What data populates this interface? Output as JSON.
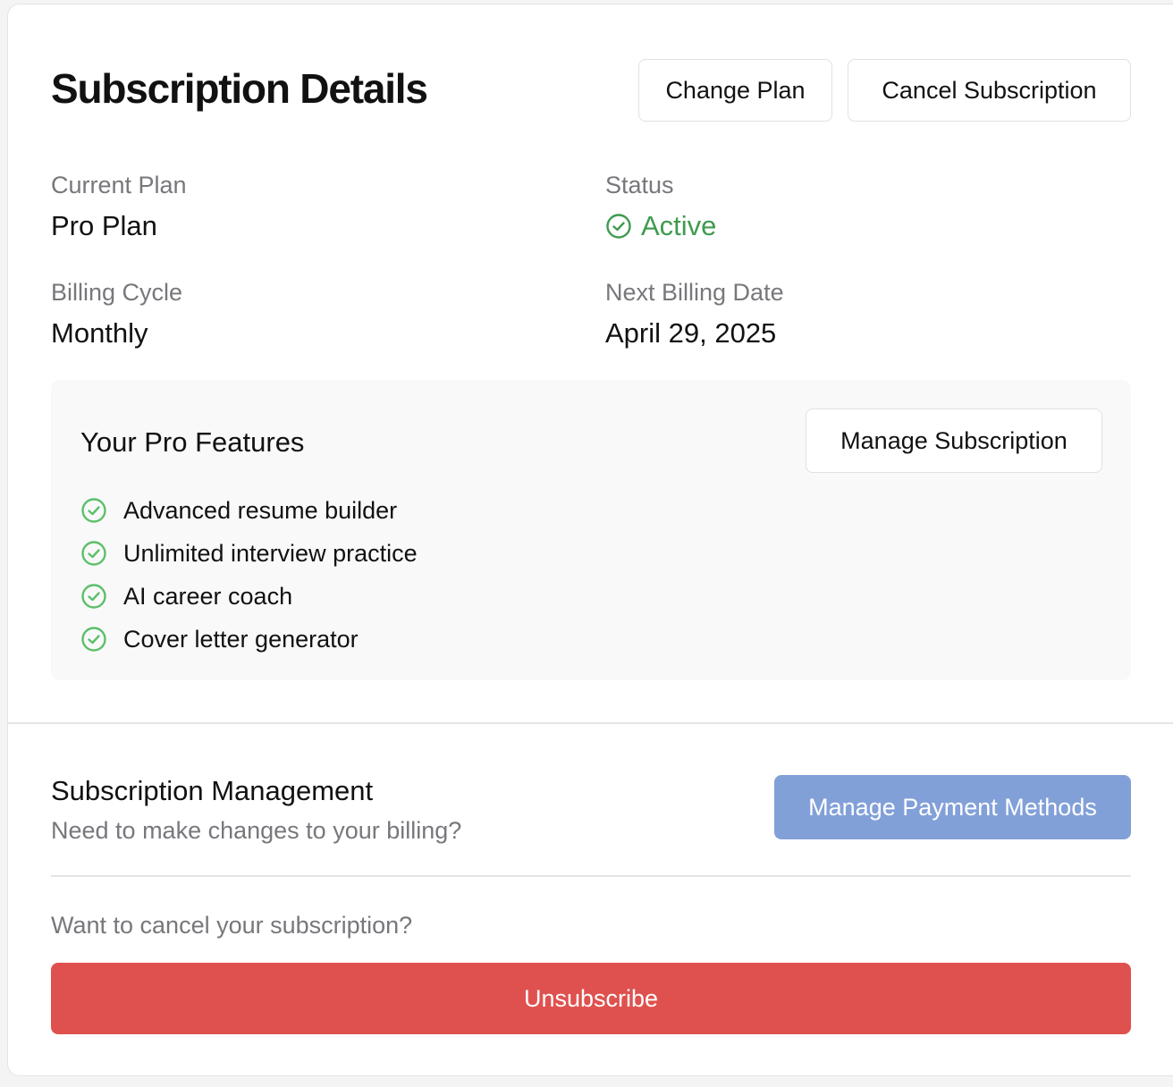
{
  "header": {
    "title": "Subscription Details",
    "change_plan_label": "Change Plan",
    "cancel_subscription_label": "Cancel Subscription"
  },
  "details": {
    "current_plan_label": "Current Plan",
    "current_plan_value": "Pro Plan",
    "status_label": "Status",
    "status_value": "Active",
    "billing_cycle_label": "Billing Cycle",
    "billing_cycle_value": "Monthly",
    "next_billing_label": "Next Billing Date",
    "next_billing_value": "April 29, 2025"
  },
  "features": {
    "title": "Your Pro Features",
    "manage_label": "Manage Subscription",
    "items": [
      "Advanced resume builder",
      "Unlimited interview practice",
      "AI career coach",
      "Cover letter generator"
    ],
    "item_icon": "check-circle-icon"
  },
  "management": {
    "title": "Subscription Management",
    "subtitle": "Need to make changes to your billing?",
    "payment_label": "Manage Payment Methods",
    "cancel_question": "Want to cancel your subscription?",
    "unsubscribe_label": "Unsubscribe"
  },
  "colors": {
    "status_active": "#3f9b4f",
    "check_icon": "#5cbf6a",
    "primary_button": "#82a0d8",
    "danger_button": "#df514e",
    "muted_text": "#77777c"
  }
}
